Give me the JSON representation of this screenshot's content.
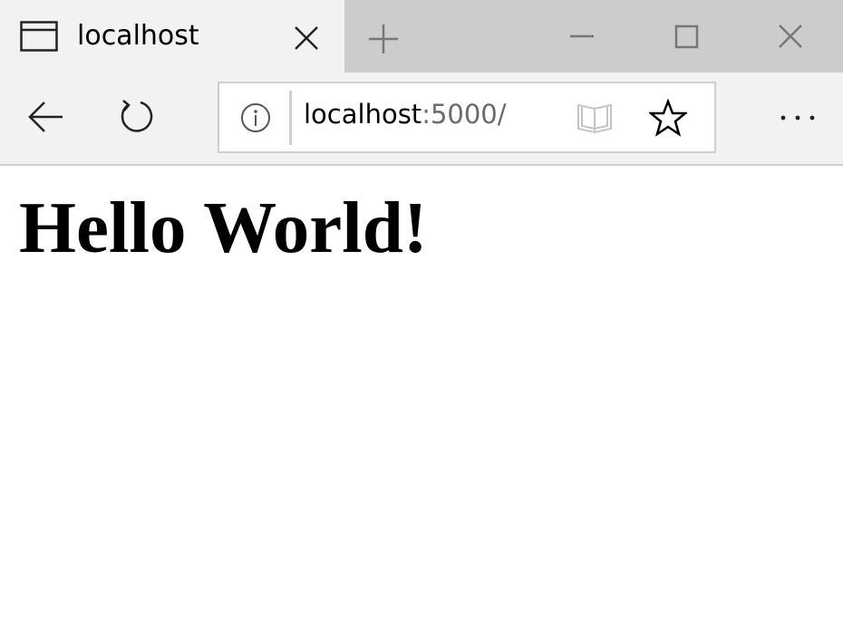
{
  "tab": {
    "title": "localhost"
  },
  "address_bar": {
    "host": "localhost",
    "rest": ":5000/"
  },
  "page": {
    "heading": "Hello World!"
  },
  "icons": {
    "tab_page": "page-icon",
    "tab_close": "close-icon",
    "new_tab": "plus-icon",
    "minimize": "minimize-icon",
    "maximize": "maximize-icon",
    "window_close": "close-icon",
    "back": "back-arrow-icon",
    "refresh": "refresh-icon",
    "site_info": "info-icon",
    "reading_view": "book-icon",
    "favorite": "star-icon",
    "more": "more-icon"
  },
  "colors": {
    "titlebar": "#cccccc",
    "tab_active": "#f2f2f2",
    "toolbar": "#f2f2f2",
    "url_secondary": "#6b6b6b"
  }
}
